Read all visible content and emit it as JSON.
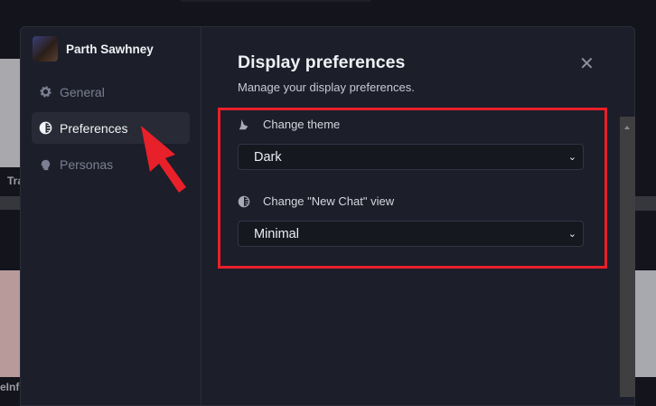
{
  "background": {
    "left_card_1": "Tra",
    "left_card_2": "eInf"
  },
  "sidebar": {
    "user_name": "Parth Sawhney",
    "items": [
      {
        "label": "General",
        "icon": "gear-icon"
      },
      {
        "label": "Preferences",
        "icon": "half-circle-icon"
      },
      {
        "label": "Personas",
        "icon": "head-icon"
      }
    ]
  },
  "main": {
    "title": "Display preferences",
    "subtitle": "Manage your display preferences.",
    "close": "✕",
    "theme": {
      "label": "Change theme",
      "value": "Dark"
    },
    "new_chat_view": {
      "label": "Change \"New Chat\" view",
      "value": "Minimal"
    }
  },
  "colors": {
    "highlight": "#e8202a",
    "modal": "#1c1e2a"
  }
}
